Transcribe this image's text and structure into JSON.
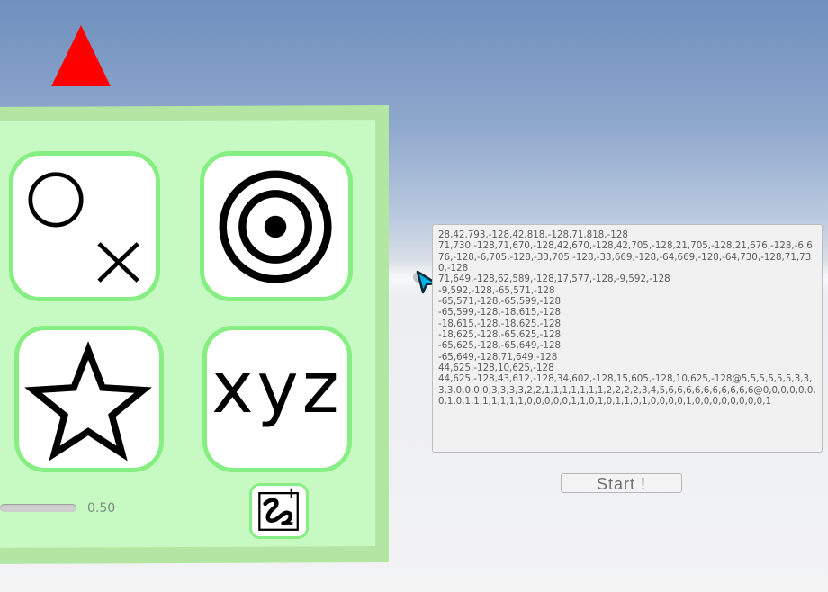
{
  "gesture_panel": {
    "cards": [
      {
        "name": "circle-x",
        "icon": "circle-cross-icon"
      },
      {
        "name": "target",
        "icon": "concentric-target-icon"
      },
      {
        "name": "star",
        "icon": "star-outline-icon"
      },
      {
        "name": "xyz",
        "label": "xyz"
      }
    ],
    "slider_value": "0.50",
    "draw_button_icon": "draw-gesture-icon"
  },
  "indicator": {
    "color": "#ff0000",
    "icon": "red-triangle-icon"
  },
  "cursor": {
    "icon": "pointer-arrow-icon",
    "color": "#00a8e0"
  },
  "output_text": "28,42,793,-128,42,818,-128,71,818,-128\n71,730,-128,71,670,-128,42,670,-128,42,705,-128,21,705,-128,21,676,-128,-6,676,-128,-6,705,-128,-33,705,-128,-33,669,-128,-64,669,-128,-64,730,-128,71,730,-128\n71,649,-128,62,589,-128,17,577,-128,-9,592,-128\n-9,592,-128,-65,571,-128\n-65,571,-128,-65,599,-128\n-65,599,-128,-18,615,-128\n-18,615,-128,-18,625,-128\n-18,625,-128,-65,625,-128\n-65,625,-128,-65,649,-128\n-65,649,-128,71,649,-128\n44,625,-128,10,625,-128\n44,625,-128,43,612,-128,34,602,-128,15,605,-128,10,625,-128@5,5,5,5,5,5,3,3,3,3,0,0,0,0,3,3,3,3,2,2,1,1,1,1,1,1,1,2,2,2,2,3,4,5,6,6,6,6,6,6,6,6,6,6@0,0,0,0,0,0,0,1,0,1,1,1,1,1,1,1,0,0,0,0,0,1,1,0,1,0,1,1,0,1,0,0,0,0,1,0,0,0,0,0,0,0,0,1",
  "start_label": "Start !",
  "colors": {
    "panel": "#b3e6a2",
    "panel_inner": "#c7fac3",
    "card_border": "#86ee83"
  }
}
